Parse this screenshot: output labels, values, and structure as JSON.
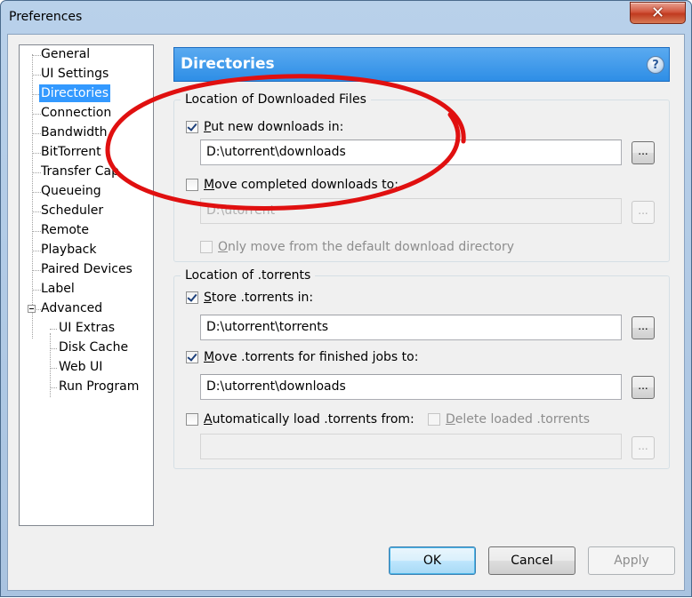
{
  "window": {
    "title": "Preferences",
    "close_glyph": "✕"
  },
  "sidebar": {
    "items": [
      {
        "label": "General"
      },
      {
        "label": "UI Settings"
      },
      {
        "label": "Directories"
      },
      {
        "label": "Connection"
      },
      {
        "label": "Bandwidth"
      },
      {
        "label": "BitTorrent"
      },
      {
        "label": "Transfer Cap"
      },
      {
        "label": "Queueing"
      },
      {
        "label": "Scheduler"
      },
      {
        "label": "Remote"
      },
      {
        "label": "Playback"
      },
      {
        "label": "Paired Devices"
      },
      {
        "label": "Label"
      },
      {
        "label": "Advanced"
      }
    ],
    "advanced_children": [
      {
        "label": "UI Extras"
      },
      {
        "label": "Disk Cache"
      },
      {
        "label": "Web UI"
      },
      {
        "label": "Run Program"
      }
    ],
    "selected": "Directories"
  },
  "header": {
    "title": "Directories",
    "help_glyph": "?"
  },
  "downloaded_group": {
    "label": "Location of Downloaded Files",
    "put_new": {
      "checked": true,
      "label_u": "P",
      "label_rest": "ut new downloads in:",
      "value": "D:\\utorrent\\downloads"
    },
    "move_completed": {
      "checked": false,
      "label_u": "M",
      "label_rest": "ove completed downloads to:",
      "value": "D:\\utorrent"
    },
    "only_move": {
      "checked": false,
      "label_u": "O",
      "label_rest": "nly move from the default download directory"
    },
    "browse_label": "..."
  },
  "torrents_group": {
    "label": "Location of .torrents",
    "store": {
      "checked": true,
      "label_u": "S",
      "label_rest": "tore .torrents in:",
      "value": "D:\\utorrent\\torrents"
    },
    "move_finished": {
      "checked": true,
      "label_u": "M",
      "label_rest": "ove .torrents for finished jobs to:",
      "value": "D:\\utorrent\\downloads"
    },
    "auto_load": {
      "checked": false,
      "label_u": "A",
      "label_rest": "utomatically load .torrents from:",
      "value": ""
    },
    "delete_loaded": {
      "checked": false,
      "label_u": "D",
      "label_rest": "elete loaded .torrents"
    },
    "browse_label": "..."
  },
  "buttons": {
    "ok": "OK",
    "cancel": "Cancel",
    "apply": "Apply"
  },
  "colors": {
    "annotation_ellipse": "#e01010",
    "selection": "#3399ff",
    "header": "#2e8ee6"
  }
}
